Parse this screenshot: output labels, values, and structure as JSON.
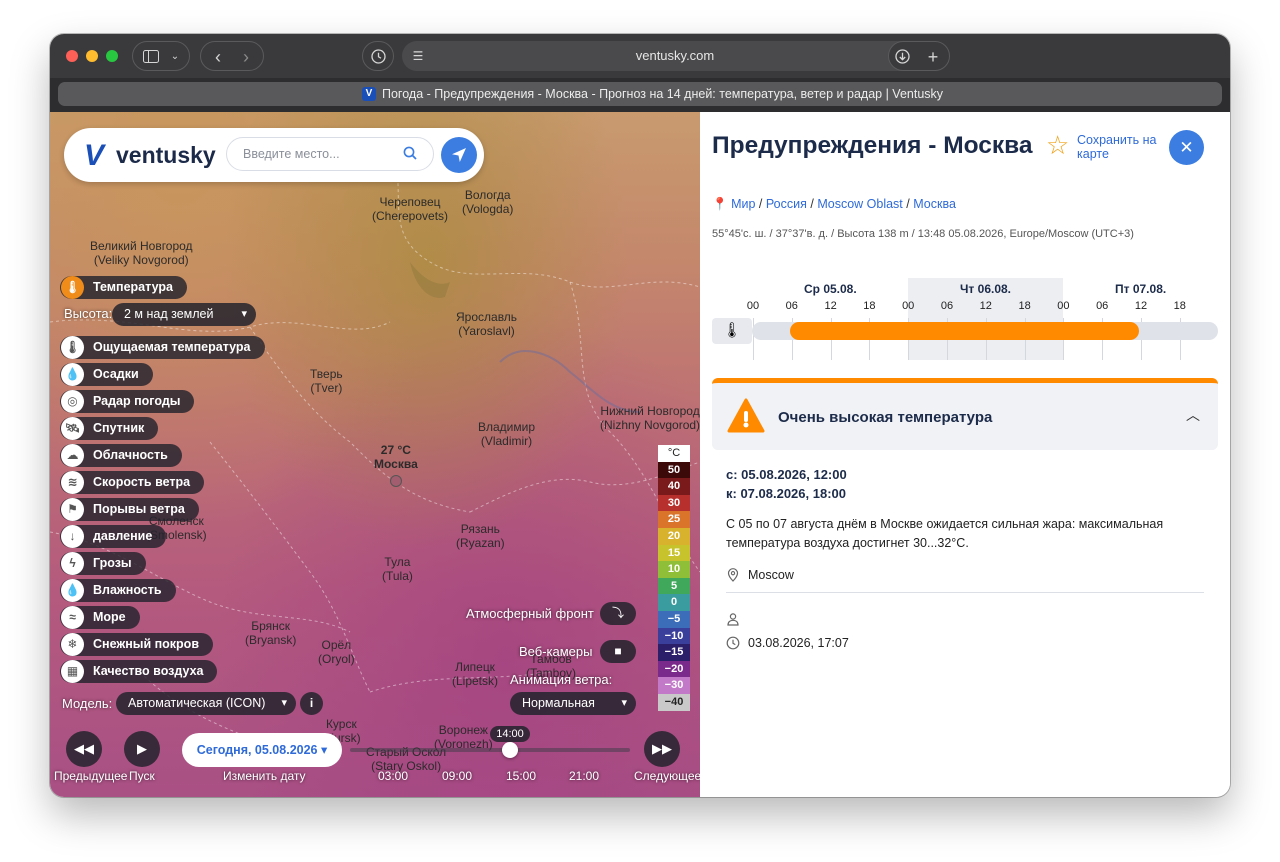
{
  "browser": {
    "url": "ventusky.com",
    "tab_title": "Погода - Предупреждения - Москва - Прогноз на 14 дней: температура, ветер и радар | Ventusky",
    "favicon_letter": "V"
  },
  "header": {
    "logo_text": "ventusky",
    "search_placeholder": "Введите место..."
  },
  "map": {
    "cities": [
      {
        "name": "Великий Новгород",
        "latin": "(Veliky Novgorod)"
      },
      {
        "name": "Череповец",
        "latin": "(Cherepovets)"
      },
      {
        "name": "Вологда",
        "latin": "(Vologda)"
      },
      {
        "name": "Ярославль",
        "latin": "(Yaroslavl)"
      },
      {
        "name": "Тверь",
        "latin": "(Tver)"
      },
      {
        "name": "Владимир",
        "latin": "(Vladimir)"
      },
      {
        "name": "Нижний Новгород",
        "latin": "(Nizhny Novgorod)"
      },
      {
        "name": "Рязань",
        "latin": "(Ryazan)"
      },
      {
        "name": "Тула",
        "latin": "(Tula)"
      },
      {
        "name": "Брянск",
        "latin": "(Bryansk)"
      },
      {
        "name": "Орёл",
        "latin": "(Oryol)"
      },
      {
        "name": "Липецк",
        "latin": "(Lipetsk)"
      },
      {
        "name": "Тамбов",
        "latin": "(Tambov)"
      },
      {
        "name": "Воронеж",
        "latin": "(Voronezh)"
      },
      {
        "name": "Старый Оскол",
        "latin": "(Stary Oskol)"
      },
      {
        "name": "Курск",
        "latin": "(Kursk)"
      },
      {
        "name": "Смоленск",
        "latin": "(Smolensk)"
      }
    ],
    "moscow_temp": "27 °C",
    "moscow_label": "Москва",
    "active_layer": "Температура",
    "height_label": "Высота:",
    "height_value": "2 м над землей",
    "layers": [
      {
        "label": "Ощущаемая температура",
        "icon": "feels-like-icon",
        "glyph": "🌡"
      },
      {
        "label": "Осадки",
        "icon": "precipitation-icon",
        "glyph": "💧"
      },
      {
        "label": "Радар погоды",
        "icon": "radar-icon",
        "glyph": "◎"
      },
      {
        "label": "Спутник",
        "icon": "satellite-icon",
        "glyph": "🛰"
      },
      {
        "label": "Облачность",
        "icon": "cloud-icon",
        "glyph": "☁"
      },
      {
        "label": "Скорость ветра",
        "icon": "wind-icon",
        "glyph": "≋"
      },
      {
        "label": "Порывы ветра",
        "icon": "gust-icon",
        "glyph": "⚑"
      },
      {
        "label": "давление",
        "icon": "pressure-icon",
        "glyph": "↓"
      },
      {
        "label": "Грозы",
        "icon": "thunder-icon",
        "glyph": "ϟ"
      },
      {
        "label": "Влажность",
        "icon": "humidity-icon",
        "glyph": "💧"
      },
      {
        "label": "Море",
        "icon": "sea-icon",
        "glyph": "≈"
      },
      {
        "label": "Снежный покров",
        "icon": "snow-icon",
        "glyph": "❄"
      },
      {
        "label": "Качество воздуха",
        "icon": "air-quality-icon",
        "glyph": "▦"
      }
    ],
    "model_label": "Модель:",
    "model_value": "Автоматическая (ICON)",
    "front_label": "Атмосферный фронт",
    "webcams_label": "Веб-камеры",
    "wind_anim_label": "Анимация ветра:",
    "wind_anim_value": "Нормальная",
    "legend_unit": "°C",
    "legend": [
      {
        "v": "50",
        "c": "#3d0a0a"
      },
      {
        "v": "40",
        "c": "#7a1a1a"
      },
      {
        "v": "30",
        "c": "#b8302e"
      },
      {
        "v": "25",
        "c": "#d9742a"
      },
      {
        "v": "20",
        "c": "#d8b22c"
      },
      {
        "v": "15",
        "c": "#c7c32c"
      },
      {
        "v": "10",
        "c": "#8fbf39"
      },
      {
        "v": "5",
        "c": "#3fa85a"
      },
      {
        "v": "0",
        "c": "#3a9c9e"
      },
      {
        "v": "−5",
        "c": "#3c6db8"
      },
      {
        "v": "−10",
        "c": "#3a3f9c"
      },
      {
        "v": "−15",
        "c": "#2c1f6a"
      },
      {
        "v": "−20",
        "c": "#7a2a8a"
      },
      {
        "v": "−30",
        "c": "#c27ac8"
      },
      {
        "v": "−40",
        "c": "#c9c9c9"
      }
    ],
    "prev_label": "Предыдущее",
    "play_label": "Пуск",
    "date_button": "Сегодня, 05.08.2026",
    "change_date_label": "Изменить дату",
    "current_time": "14:00",
    "times": [
      "03:00",
      "09:00",
      "15:00",
      "21:00"
    ],
    "next_label": "Следующее"
  },
  "panel": {
    "title": "Предупреждения - Москва",
    "save_line1": "Сохранить на",
    "save_line2": "карте",
    "breadcrumbs": [
      "Мир",
      "Россия",
      "Moscow Oblast",
      "Москва"
    ],
    "coords": "55°45'с. ш. / 37°37'в. д. / Высота 138 m / 13:48 05.08.2026, Europe/Moscow (UTC+3)",
    "days": [
      "Ср 05.08.",
      "Чт 06.08.",
      "Пт 07.08."
    ],
    "hours": [
      "00",
      "06",
      "12",
      "18",
      "00",
      "06",
      "12",
      "18",
      "00",
      "06",
      "12",
      "18"
    ],
    "warning_title": "Очень высокая температура",
    "from": "с: 05.08.2026, 12:00",
    "to": "к: 07.08.2026, 18:00",
    "description": "С 05 по 07 августа днём в Москве ожидается сильная жара: максимальная температура воздуха достигнет 30...32°C.",
    "location": "Moscow",
    "issued": "03.08.2026, 17:07",
    "accent": "#ff8a00",
    "link_color": "#2e6ad8"
  }
}
